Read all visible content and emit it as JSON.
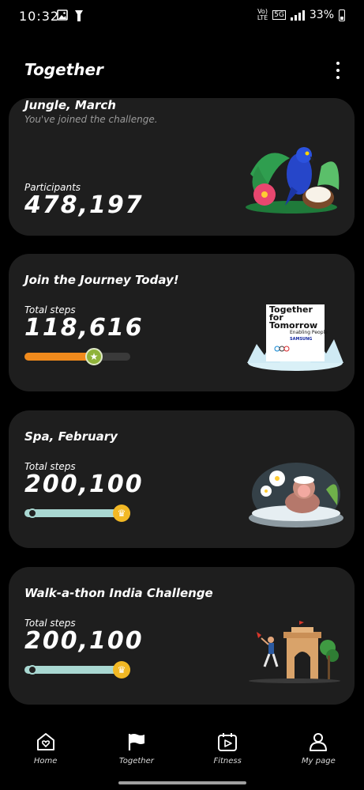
{
  "status_bar": {
    "time": "10:32",
    "network_top": "Vo)",
    "network_bottom": "LTE",
    "network_type": "5G",
    "battery": "33%"
  },
  "header": {
    "title": "Together",
    "more_icon": "more-vert-icon"
  },
  "cards": [
    {
      "title": "Jungle, March",
      "subtitle": "You've joined the challenge.",
      "stat_label": "Participants",
      "stat_value": "478,197"
    },
    {
      "title": "Join the Journey Today!",
      "stat_label": "Total steps",
      "stat_value": "118,616",
      "progress": 0.66,
      "progress_color": "#f08a1c",
      "art_line1": "Together",
      "art_line2": "for",
      "art_line3": "Tomorrow",
      "art_line4": "Enabling People",
      "art_brand": "SAMSUNG"
    },
    {
      "title": "Spa, February",
      "stat_label": "Total steps",
      "stat_value": "200,100",
      "progress": 1.0,
      "progress_color": "#a9d8d2"
    },
    {
      "title": "Walk-a-thon India Challenge",
      "stat_label": "Total steps",
      "stat_value": "200,100",
      "progress": 1.0,
      "progress_color": "#a9d8d2"
    }
  ],
  "bottom_nav": [
    {
      "label": "Home",
      "icon": "home-heart-icon"
    },
    {
      "label": "Together",
      "icon": "flag-icon"
    },
    {
      "label": "Fitness",
      "icon": "calendar-play-icon"
    },
    {
      "label": "My page",
      "icon": "person-icon"
    }
  ]
}
